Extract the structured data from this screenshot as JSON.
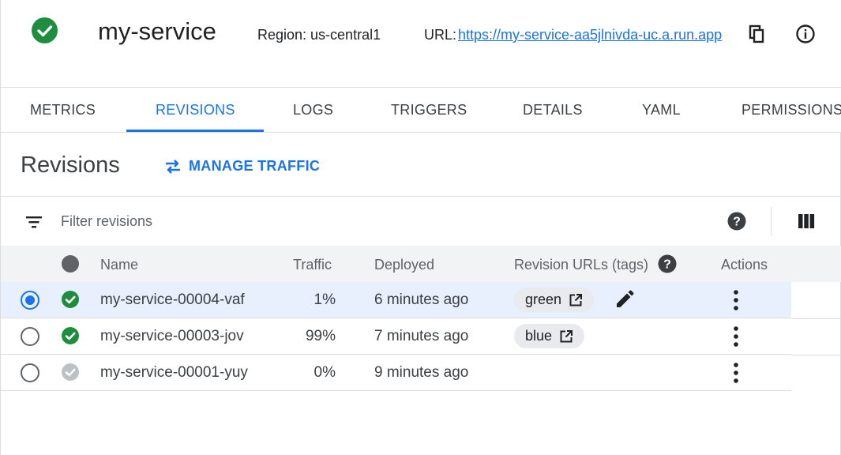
{
  "header": {
    "service_name": "my-service",
    "status_icon": "check-circle-icon",
    "region_text": "Region: us-central1",
    "url_label": "URL:",
    "url_value": "https://my-service-aa5jlnivda-uc.a.run.app",
    "copy_icon": "copy-icon",
    "info_icon": "info-icon"
  },
  "tabs": [
    {
      "label": "METRICS",
      "active": false
    },
    {
      "label": "REVISIONS",
      "active": true
    },
    {
      "label": "LOGS",
      "active": false
    },
    {
      "label": "TRIGGERS",
      "active": false
    },
    {
      "label": "DETAILS",
      "active": false
    },
    {
      "label": "YAML",
      "active": false
    },
    {
      "label": "PERMISSIONS",
      "active": false
    }
  ],
  "revisions": {
    "title": "Revisions",
    "manage_traffic_label": "MANAGE TRAFFIC",
    "filter_placeholder": "Filter revisions",
    "columns": {
      "name": "Name",
      "traffic": "Traffic",
      "deployed": "Deployed",
      "urls": "Revision URLs (tags)",
      "actions": "Actions"
    },
    "rows": [
      {
        "name": "my-service-00004-vaf",
        "traffic": "1%",
        "deployed": "6 minutes ago",
        "tag": "green",
        "selected": true,
        "status": "active"
      },
      {
        "name": "my-service-00003-jov",
        "traffic": "99%",
        "deployed": "7 minutes ago",
        "tag": "blue",
        "selected": false,
        "status": "active"
      },
      {
        "name": "my-service-00001-yuy",
        "traffic": "0%",
        "deployed": "9 minutes ago",
        "tag": "",
        "selected": false,
        "status": "inactive"
      }
    ]
  },
  "colors": {
    "accent": "#1a73e8",
    "status_green": "#1e8e3e",
    "status_gray": "#bdc1c6",
    "selected_row": "#e8f0fe"
  }
}
